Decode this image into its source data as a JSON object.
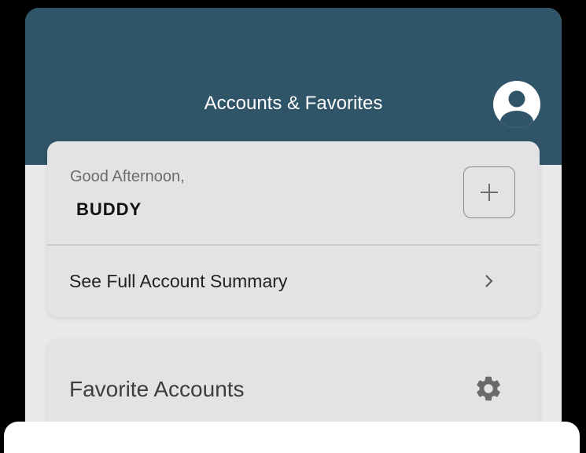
{
  "header": {
    "title": "Accounts & Favorites",
    "icon": "account-circle-icon",
    "color": "#305569"
  },
  "greeting_card": {
    "greeting": "Good Afternoon,",
    "name": "BUDDY",
    "add_icon": "plus-icon"
  },
  "summary": {
    "label": "See Full Account Summary",
    "icon": "chevron-right-icon"
  },
  "favorites": {
    "label": "Favorite Accounts",
    "icon": "gear-icon"
  },
  "colors": {
    "background": "#e9e9eb",
    "card": "#e3e3e5",
    "text": "#222222"
  }
}
